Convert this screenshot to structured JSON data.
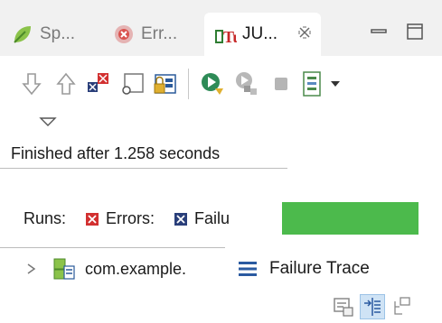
{
  "tabs": [
    {
      "label": "Sp...",
      "icon": "spring-leaf-icon",
      "active": false
    },
    {
      "label": "Err...",
      "icon": "error-log-icon",
      "active": false
    },
    {
      "label": "JU...",
      "icon": "junit-icon",
      "active": true
    }
  ],
  "window_controls": [
    "minimize-icon",
    "maximize-icon"
  ],
  "toolbar_icons": [
    "next-failure-icon",
    "previous-failure-icon",
    "show-failures-only-icon",
    "scroll-lock-icon",
    "history-lock-icon",
    "rerun-test-icon",
    "rerun-failed-first-icon",
    "stop-icon",
    "test-run-history-icon",
    "dropdown-arrow-icon",
    "view-menu-icon"
  ],
  "status": {
    "text": "Finished after 1.258 seconds"
  },
  "counters": {
    "runs_label": "Runs:",
    "errors_label": "Errors:",
    "failures_label": "Failu"
  },
  "progress": {
    "fraction": 1.0,
    "color": "#4cba4c"
  },
  "tree": {
    "root_label": "com.example."
  },
  "failure_trace": {
    "title": "Failure Trace"
  },
  "trace_toolbar_icons": [
    "compare-results-icon",
    "filter-stack-trace-icon",
    "copy-trace-icon"
  ],
  "colors": {
    "error_red": "#d23030",
    "failure_blue": "#2a3f7a",
    "progress_green": "#4cba4c"
  }
}
